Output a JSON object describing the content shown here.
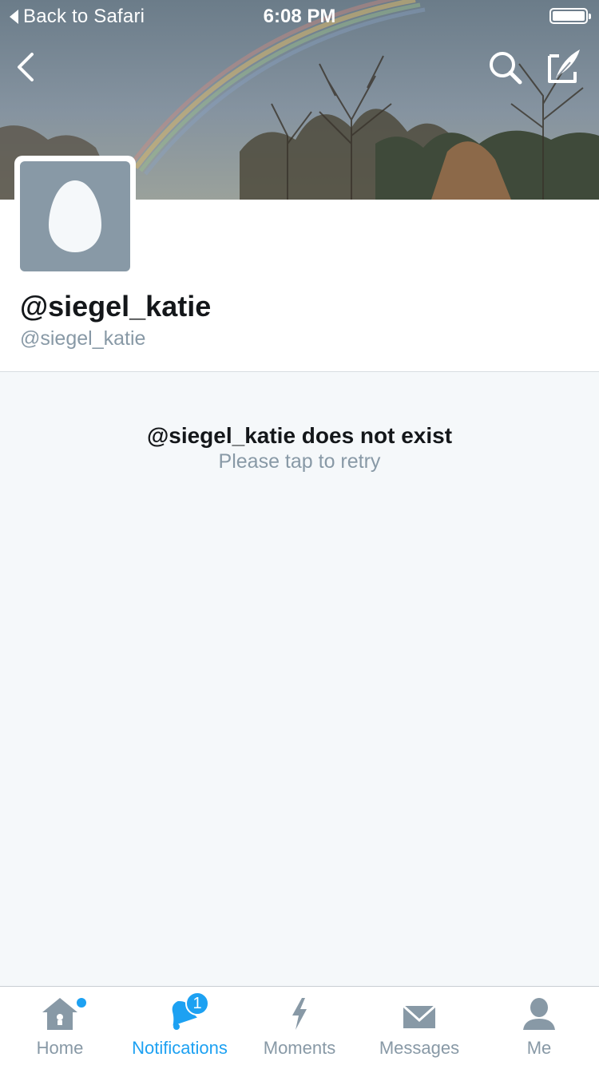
{
  "status_bar": {
    "back_label": "Back to Safari",
    "time": "6:08 PM"
  },
  "profile": {
    "display_name": "@siegel_katie",
    "screen_name": "@siegel_katie"
  },
  "error": {
    "title": "@siegel_katie does not exist",
    "subtitle": "Please tap to retry"
  },
  "tabs": [
    {
      "label": "Home",
      "icon": "home-icon",
      "has_dot": true
    },
    {
      "label": "Notifications",
      "icon": "bell-icon",
      "active": true,
      "badge": "1"
    },
    {
      "label": "Moments",
      "icon": "lightning-icon"
    },
    {
      "label": "Messages",
      "icon": "envelope-icon"
    },
    {
      "label": "Me",
      "icon": "person-icon"
    }
  ],
  "colors": {
    "accent": "#1da1f2",
    "inactive": "#8899a6",
    "background": "#f5f8fa",
    "text": "#14171a"
  }
}
